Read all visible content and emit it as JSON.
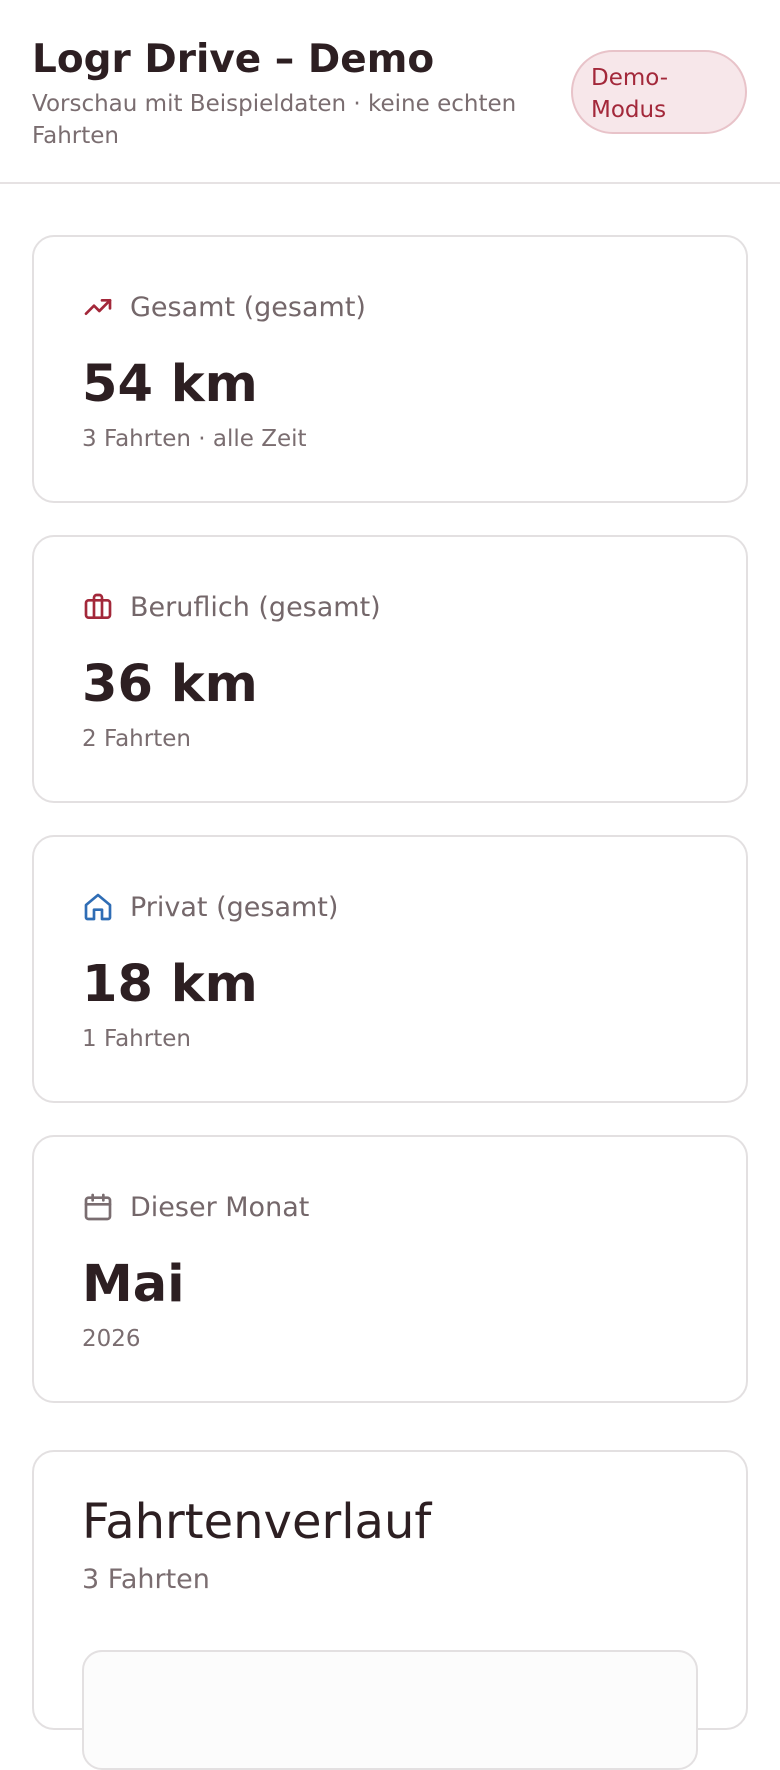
{
  "header": {
    "title": "Logr Drive – Demo",
    "subtitle": "Vorschau mit Beispieldaten · keine echten Fahrten",
    "badge": "Demo-Modus"
  },
  "stats": [
    {
      "icon": "trending-up-icon",
      "icon_color": "#a3283a",
      "label": "Gesamt (gesamt)",
      "value": "54 km",
      "sub": "3 Fahrten · alle Zeit"
    },
    {
      "icon": "briefcase-icon",
      "icon_color": "#a3283a",
      "label": "Beruflich (gesamt)",
      "value": "36 km",
      "sub": "2 Fahrten"
    },
    {
      "icon": "home-icon",
      "icon_color": "#2f6db5",
      "label": "Privat (gesamt)",
      "value": "18 km",
      "sub": "1 Fahrten"
    },
    {
      "icon": "calendar-icon",
      "icon_color": "#7a6d70",
      "label": "Dieser Monat",
      "value": "Mai",
      "sub": "2026"
    }
  ],
  "history": {
    "title": "Fahrtenverlauf",
    "count": "3 Fahrten"
  },
  "colors": {
    "accent": "#a3283a",
    "badge_bg": "#f7e7ea",
    "privat": "#2f6db5"
  }
}
